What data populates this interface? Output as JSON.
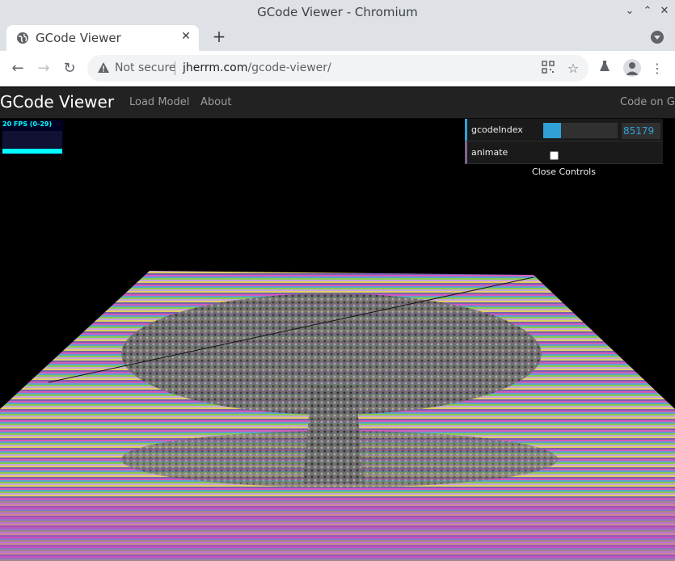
{
  "window": {
    "title": "GCode Viewer - Chromium"
  },
  "tab": {
    "title": "GCode Viewer",
    "close_glyph": "✕",
    "new_tab_glyph": "+"
  },
  "toolbar": {
    "security_label": "Not secure",
    "url_host": "jherrm.com",
    "url_path": "/gcode-viewer/"
  },
  "app": {
    "brand": "GCode Viewer",
    "nav": [
      "Load Model",
      "About"
    ],
    "github_link": "Code on Git"
  },
  "stats": {
    "fps_text": "20 FPS (0-29)"
  },
  "controls": {
    "gcode_index_label": "gcodeIndex",
    "gcode_index_value": "85179",
    "gcode_index_fill_fraction": 0.24,
    "animate_label": "animate",
    "animate_checked": false,
    "close_label": "Close Controls"
  },
  "colors": {
    "accent": "#2fa1d6",
    "navbar": "#222222",
    "bool_accent": "#806787"
  }
}
